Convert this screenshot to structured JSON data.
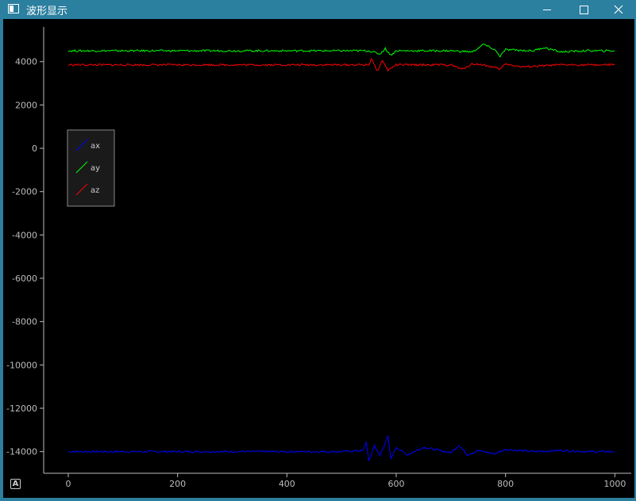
{
  "window": {
    "title": "波形显示",
    "auto_button_label": "A"
  },
  "chart_data": {
    "type": "line",
    "title": "",
    "xlabel": "",
    "ylabel": "",
    "xlim": [
      -45,
      1030
    ],
    "ylim": [
      -15000,
      5600
    ],
    "x_ticks": [
      0,
      200,
      400,
      600,
      800,
      1000
    ],
    "y_ticks": [
      4000,
      2000,
      0,
      -2000,
      -4000,
      -6000,
      -8000,
      -10000,
      -12000,
      -14000
    ],
    "grid": false,
    "legend_placement": "upper-left",
    "background": "#000000",
    "series": [
      {
        "name": "ax",
        "color": "#0000ff",
        "x": [
          0,
          100,
          200,
          300,
          400,
          500,
          540,
          545,
          550,
          560,
          570,
          580,
          585,
          590,
          600,
          620,
          650,
          700,
          715,
          730,
          750,
          780,
          800,
          850,
          900,
          950,
          1000
        ],
        "y": [
          -14000,
          -14000,
          -14000,
          -14000,
          -14000,
          -14000,
          -13950,
          -13550,
          -14450,
          -13700,
          -14200,
          -13600,
          -13300,
          -14350,
          -13800,
          -14150,
          -13800,
          -14050,
          -13700,
          -14150,
          -13950,
          -14100,
          -13900,
          -14000,
          -13950,
          -14000,
          -14000
        ]
      },
      {
        "name": "ay",
        "color": "#00ff00",
        "x": [
          0,
          100,
          200,
          300,
          400,
          500,
          550,
          570,
          580,
          590,
          600,
          700,
          740,
          760,
          780,
          790,
          800,
          850,
          870,
          900,
          950,
          1000
        ],
        "y": [
          4500,
          4500,
          4500,
          4500,
          4500,
          4500,
          4500,
          4350,
          4600,
          4300,
          4500,
          4500,
          4450,
          4800,
          4550,
          4250,
          4550,
          4500,
          4650,
          4450,
          4500,
          4500
        ]
      },
      {
        "name": "az",
        "color": "#ff0000",
        "x": [
          0,
          100,
          200,
          300,
          400,
          500,
          550,
          555,
          565,
          575,
          585,
          600,
          700,
          720,
          740,
          760,
          790,
          800,
          830,
          900,
          950,
          1000
        ],
        "y": [
          3850,
          3850,
          3850,
          3850,
          3850,
          3850,
          3850,
          4150,
          3550,
          4050,
          3600,
          3850,
          3850,
          3650,
          3900,
          3850,
          3650,
          3900,
          3750,
          3850,
          3850,
          3850
        ]
      }
    ]
  }
}
